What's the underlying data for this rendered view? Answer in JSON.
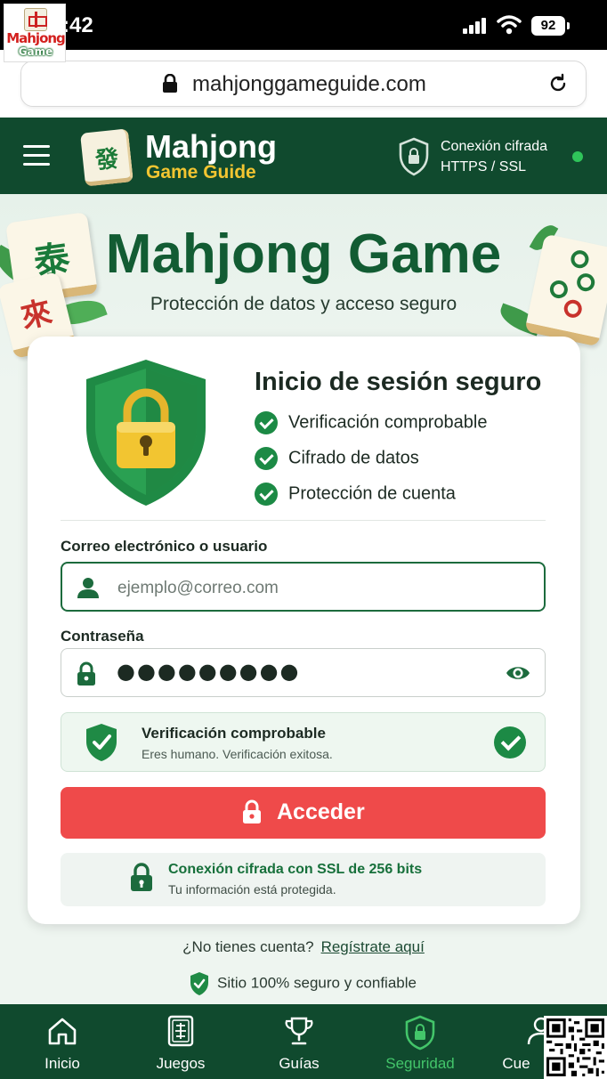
{
  "status_bar": {
    "time": ":42",
    "battery": "92"
  },
  "app_logo": {
    "line1": "Mahjong",
    "line2": "Game"
  },
  "browser": {
    "url": "mahjonggameguide.com"
  },
  "header": {
    "brand_name": "Mahjong",
    "brand_sub": "Game Guide",
    "brand_tile_glyph": "發",
    "connection_line1": "Conexión cifrada",
    "connection_line2": "HTTPS / SSL",
    "status_color": "#2fc45a"
  },
  "hero": {
    "title": "Mahjong Game",
    "subtitle": "Protección de datos y acceso seguro",
    "tile_glyph_1": "泰",
    "tile_glyph_2": "來"
  },
  "login": {
    "title": "Inicio de sesión seguro",
    "features": [
      "Verificación comprobable",
      "Cifrado de datos",
      "Protección de cuenta"
    ],
    "email_label": "Correo electrónico o usuario",
    "email_placeholder": "ejemplo@correo.com",
    "password_label": "Contraseña",
    "password_value": "●●●●●●●●●",
    "verify_title": "Verificación comprobable",
    "verify_sub": "Eres humano. Verificación exitosa.",
    "submit_label": "Acceder",
    "ssl_title": "Conexión cifrada con SSL de 256 bits",
    "ssl_sub": "Tu información está protegida."
  },
  "footer": {
    "no_account": "¿No tienes cuenta?",
    "register_link": "Regístrate aquí",
    "safe_text": "Sitio 100% seguro y confiable"
  },
  "nav": {
    "items": [
      "Inicio",
      "Juegos",
      "Guías",
      "Seguridad",
      "Cue"
    ],
    "active": "Seguridad",
    "active_color": "#43c56a"
  },
  "colors": {
    "primary": "#104a2e",
    "accent": "#ef4a4a",
    "check": "#1c8a45",
    "gold": "#f2c531"
  }
}
